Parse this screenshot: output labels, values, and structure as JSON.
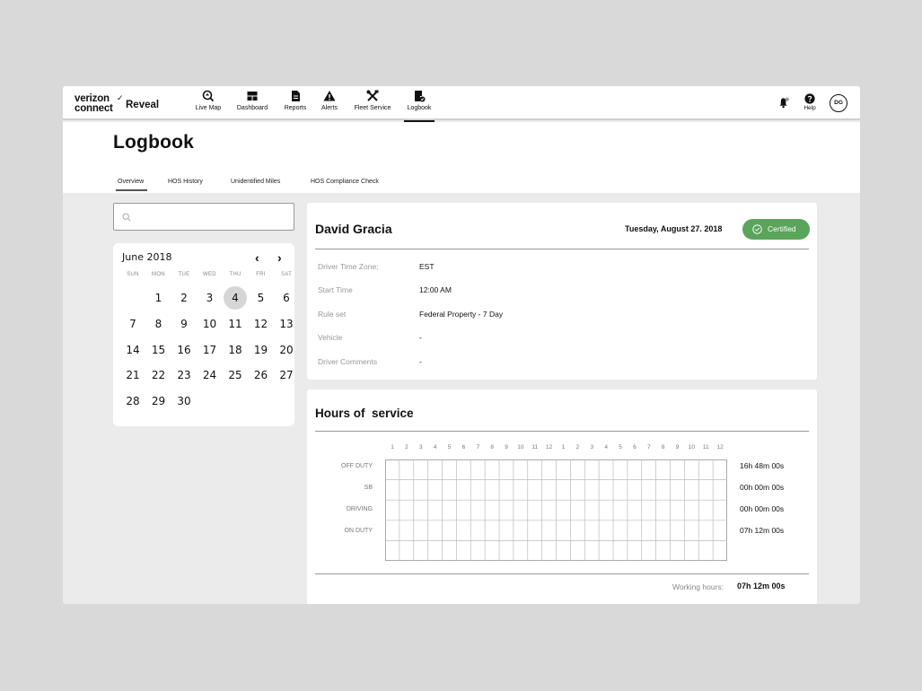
{
  "app": {
    "logo_line1": "verizon",
    "logo_check": "✓",
    "logo_line2": "connect",
    "logo_product": "Reveal"
  },
  "nav": [
    {
      "label": "Live Map",
      "icon": "live-map-icon"
    },
    {
      "label": "Dashboard",
      "icon": "dashboard-icon"
    },
    {
      "label": "Reports",
      "icon": "reports-icon"
    },
    {
      "label": "Alerts",
      "icon": "alerts-icon"
    },
    {
      "label": "Fleet Service",
      "icon": "fleet-service-icon"
    },
    {
      "label": "Logbook",
      "icon": "logbook-icon",
      "active": true
    }
  ],
  "topbar_right": {
    "help_label": "Help",
    "avatar_initials": "DG"
  },
  "page": {
    "title": "Logbook",
    "tabs": [
      "Overview",
      "HOS History",
      "Unidentified Miles",
      "HOS Compliance Check"
    ],
    "active_tab": "Overview"
  },
  "search": {
    "value": "",
    "placeholder": ""
  },
  "calendar": {
    "month_label": "June 2018",
    "weekdays": [
      "SUN",
      "MON",
      "TUE",
      "WED",
      "THU",
      "FRI",
      "SAT"
    ],
    "first_weekday_index": 1,
    "days_in_month": 30,
    "selected_day": 4
  },
  "driver": {
    "name": "David Gracia",
    "date": "Tuesday, August 27. 2018",
    "status": "Certified",
    "status_color": "#5ba45b",
    "fields": [
      {
        "label": "Driver Time Zone;",
        "value": "EST"
      },
      {
        "label": "Start Time",
        "value": "12:00 AM"
      },
      {
        "label": "Rule set",
        "value": "Federal Property - 7 Day"
      },
      {
        "label": "Vehicle",
        "value": "-"
      },
      {
        "label": "Driver Comments",
        "value": "-"
      }
    ]
  },
  "hours": {
    "title": "Hours of  service",
    "ticks": [
      "1",
      "2",
      "3",
      "4",
      "5",
      "6",
      "7",
      "8",
      "9",
      "10",
      "11",
      "12",
      "1",
      "2",
      "3",
      "4",
      "5",
      "6",
      "7",
      "8",
      "9",
      "10",
      "11",
      "12"
    ],
    "rows": [
      {
        "label": "OFF DUTY",
        "total": "16h 48m 00s"
      },
      {
        "label": "SB",
        "total": "00h 00m 00s"
      },
      {
        "label": "DRIVING",
        "total": "00h 00m 00s"
      },
      {
        "label": "ON DUTY",
        "total": "07h 12m 00s"
      }
    ],
    "working_hours_label": "Working hours:",
    "working_hours_value": "07h 12m 00s"
  }
}
